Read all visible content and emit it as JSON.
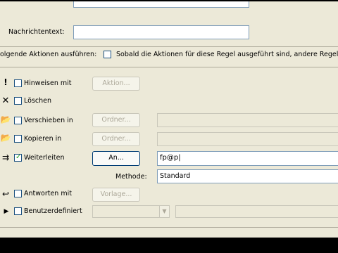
{
  "message": {
    "label": "Nachrichtentext:",
    "value": ""
  },
  "actions_header": {
    "label": "olgende Aktionen ausführen:",
    "stop_rules_checkbox_label": "Sobald die Aktionen für diese Regel ausgeführt sind, andere Regeln ig"
  },
  "rows": {
    "hinweisen": {
      "icon": "exclamation-icon",
      "label": "Hinweisen mit",
      "checked": false,
      "button": "Aktion..."
    },
    "loeschen": {
      "icon": "delete-x-icon",
      "label": "Löschen",
      "checked": false
    },
    "verschieben": {
      "icon": "move-folder-icon",
      "label": "Verschieben in",
      "checked": false,
      "button": "Ordner...",
      "field": ""
    },
    "kopieren": {
      "icon": "copy-folder-icon",
      "label": "Kopieren in",
      "checked": false,
      "button": "Ordner...",
      "field": ""
    },
    "weiterleiten": {
      "icon": "forward-icon",
      "label": "Weiterleiten",
      "checked": true,
      "button": "An...",
      "field": "fp@p|",
      "method_label": "Methode:",
      "method_value": "Standard"
    },
    "antworten": {
      "icon": "reply-icon",
      "label": "Antworten mit",
      "checked": false,
      "button": "Vorlage..."
    },
    "benutzerdefiniert": {
      "icon": "play-arrow-icon",
      "label": "Benutzerdefiniert",
      "checked": false,
      "select": "",
      "field": ""
    }
  },
  "colors": {
    "panel": "#ECE9D8",
    "field_border": "#7F9DB9",
    "check": "#21A121",
    "disabled_text": "#ACA899"
  }
}
